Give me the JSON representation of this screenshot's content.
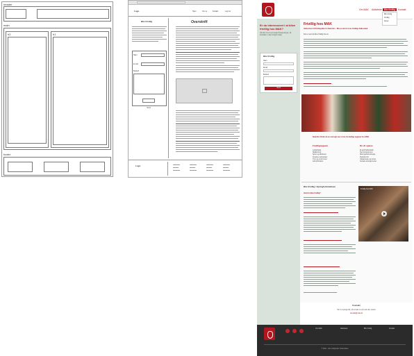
{
  "wireframe_lofi": {
    "header_label": "header",
    "main_label": "main",
    "h2_label": "h2",
    "h1_label": "h1",
    "footer_label": "footer"
  },
  "wireframe_mid": {
    "logo_text": "Logo",
    "nav": [
      "Hjem",
      "Om os",
      "Kontakt",
      "Log ind"
    ],
    "sidebar_heading": "Bliv frivillig",
    "main_heading": "Overskrift",
    "form_labels": [
      "Navn",
      "E-mail",
      "Besked"
    ],
    "submit_label": "Send",
    "footer_logo": "Logo"
  },
  "site": {
    "nav": [
      "Om MAK",
      "Aktiviteter",
      "Bliv frivillig",
      "Kontakt"
    ],
    "nav_active_index": 2,
    "nav_dropdown": [
      "Bliv frivillig",
      "Frivillig",
      "Donér"
    ],
    "join_heading": "Er du interesseret i at blive frivillig hos MAK?",
    "join_text": "Så skriv til os med nogle få oplysninger, så kontakter vi dig hurtigst muligt",
    "form_title": "Bliv frivillig",
    "form_labels": [
      "Navn",
      "Email",
      "Besked"
    ],
    "form_button": "Send",
    "main_title": "Frivillig hos MAK",
    "main_subtitle": "Velkommen til frivilligsiden for Nørrebro - Bliv en del af vores frivillige fællesskab",
    "intro": "Det er nemt at blive frivillig hos os",
    "photo_caption": "Nedenfor finder du en oversigt over vores forskellige opgaver hos MAK",
    "col1_heading": "Frivilligopgaver",
    "col1_items": [
      "Lektiehjælp",
      "Madlavning",
      "Sport og aktiviteter",
      "Kreative værksteder",
      "Ture og ud af huset",
      "Administration"
    ],
    "col2_heading": "Du vil opleve",
    "col2_items": [
      "Et godt fællesskab",
      "Nye kompetencer",
      "Meningsfuldt arbejde",
      "Fleksibel tid",
      "Uddannelse og kurser",
      "Sociale arrangementer"
    ],
    "section2_title": "Bliv frivillig i Springforbindelsen",
    "section2_heading": "Hvorfor blive frivillig?",
    "video_title": "Frivillig hos MAK",
    "contact_heading": "Kontakt",
    "contact_text": "Har du spørgsmål, så kontakt os på mail eller telefon",
    "contact_link": "kontakt@mak.dk",
    "footer_cols": [
      "Om MAK",
      "Aktiviteter",
      "Bliv frivillig",
      "Kontakt"
    ],
    "footer_copyright": "© MAK - Alle rettigheder forbeholdes",
    "colors": {
      "brand_red": "#b3151f",
      "sidebar_green": "#d9e3dc",
      "footer_dark": "#2b2b2b"
    },
    "social_icons": [
      "facebook-icon",
      "instagram-icon",
      "linkedin-icon"
    ]
  }
}
